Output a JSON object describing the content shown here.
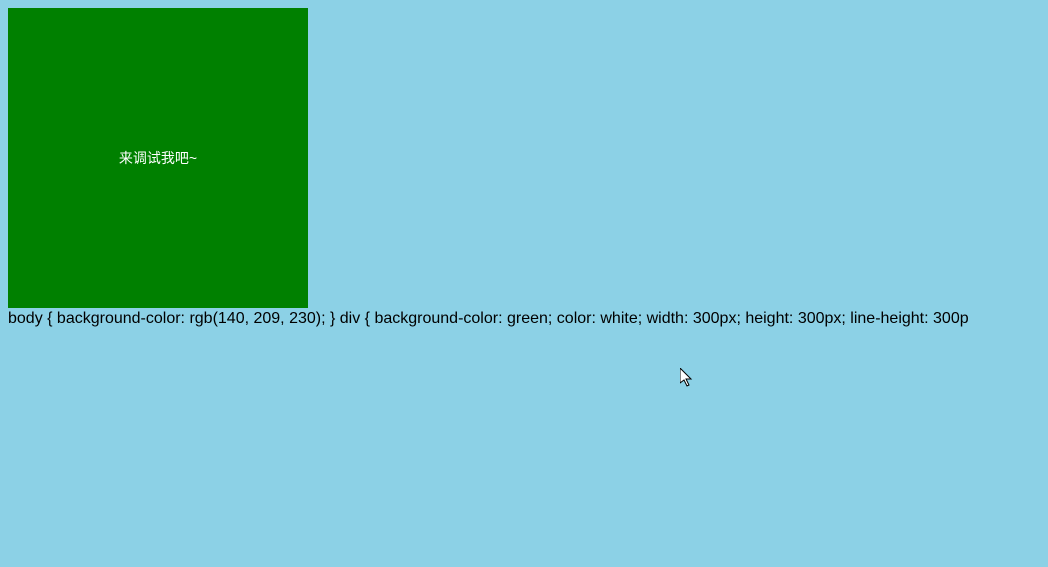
{
  "box": {
    "text": "来调试我吧~"
  },
  "cssRule": "body { background-color: rgb(140, 209, 230); } div { background-color: green; color: white; width: 300px; height: 300px; line-height: 300p"
}
